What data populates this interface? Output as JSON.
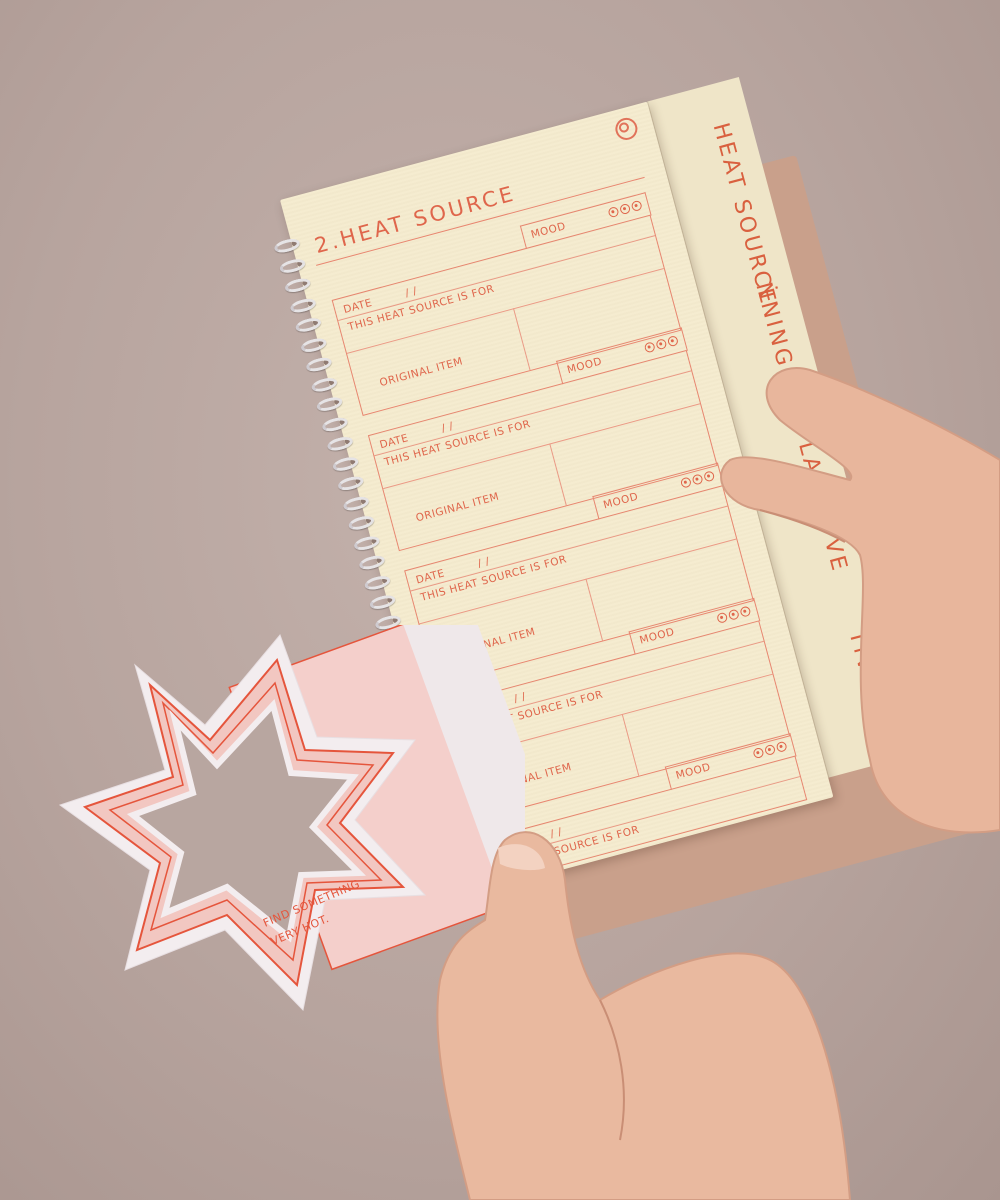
{
  "notebook": {
    "page_title": "2.HEAT SOURCE",
    "side_tabs": [
      "HEAT SOURCE",
      "ṄNING",
      "LAGE",
      "VE",
      "TIVITY"
    ],
    "entry_labels": {
      "mood": "MOOD",
      "date": "DATE",
      "date_separators": "/     /",
      "purpose": "THIS HEAT SOURCE IS FOR",
      "original_item": "ORIGINAL ITEM"
    },
    "entry_count": 5
  },
  "card": {
    "line1": "FIND SOMETHING",
    "line2": "VERY HOT."
  },
  "colors": {
    "background": "#b9a7a1",
    "paper": "#f5ecd0",
    "ink": "#e0654b",
    "card_pink": "#f4cfcb",
    "skin": "#e9b99f"
  }
}
